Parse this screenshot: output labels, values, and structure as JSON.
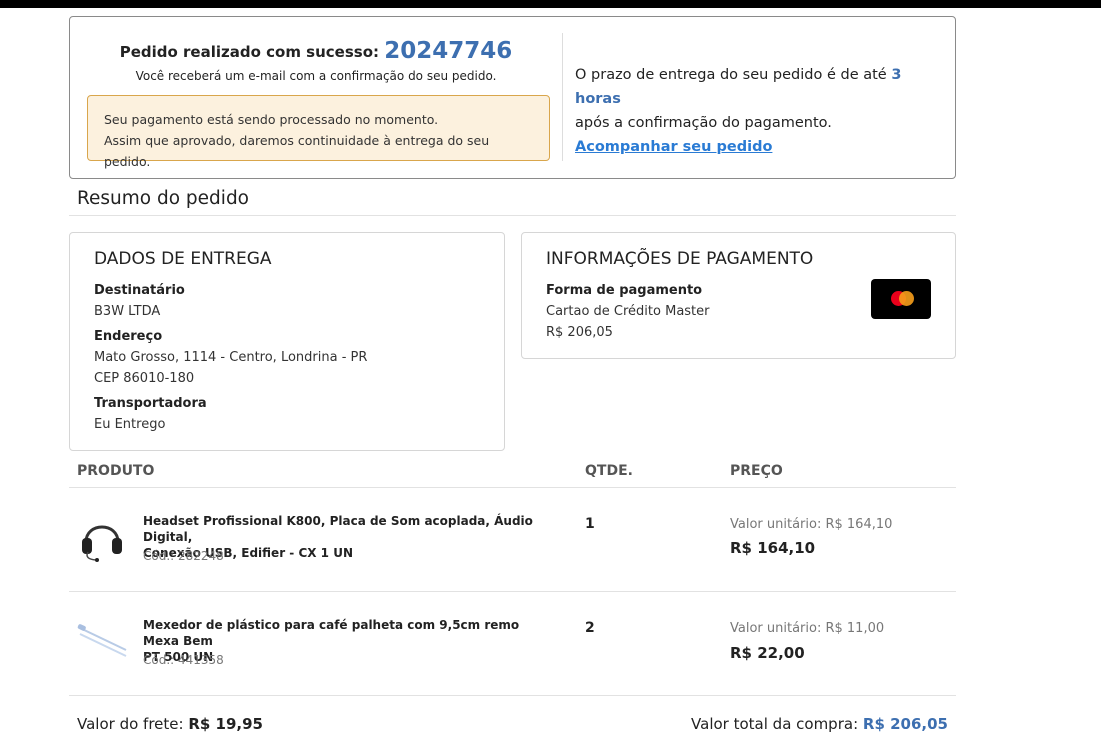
{
  "confirmation": {
    "title_prefix": "Pedido realizado com sucesso:",
    "order_number": "20247746",
    "email_note": "Você receberá um e-mail com a confirmação do seu pedido.",
    "alert_line1": "Seu pagamento está sendo processado no momento.",
    "alert_line2": "Assim que aprovado, daremos continuidade à entrega do seu pedido.",
    "delivery_text_before": "O prazo de entrega do seu pedido é de até",
    "delivery_hours": "3 horas",
    "delivery_text_after": "após a confirmação do pagamento.",
    "track_link": "Acompanhar seu pedido"
  },
  "summary": {
    "title": "Resumo do pedido"
  },
  "delivery": {
    "heading": "DADOS DE ENTREGA",
    "recipient_label": "Destinatário",
    "recipient": "B3W LTDA",
    "address_label": "Endereço",
    "address_line1": "Mato Grosso, 1114 - Centro, Londrina - PR",
    "address_line2": "CEP 86010-180",
    "carrier_label": "Transportadora",
    "carrier": "Eu Entrego"
  },
  "payment": {
    "heading": "INFORMAÇÕES DE PAGAMENTO",
    "method_label": "Forma de pagamento",
    "method": "Cartao de Crédito Master",
    "amount": "R$ 206,05",
    "card_icon": "mastercard-icon"
  },
  "table": {
    "headers": {
      "product": "PRODUTO",
      "qty": "QTDE.",
      "price": "PREÇO"
    },
    "items": [
      {
        "name_line1": "Headset Profissional K800, Placa de Som acoplada, Áudio Digital,",
        "name_line2": "Conexão USB, Edifier - CX 1 UN",
        "code": "Cód.: 282248",
        "qty": "1",
        "unit_price": "Valor unitário: R$ 164,10",
        "total": "R$ 164,10",
        "image": "headset-icon"
      },
      {
        "name_line1": "Mexedor de plástico para café palheta com 9,5cm remo Mexa Bem",
        "name_line2": "PT 500 UN",
        "code": "Cód.: 441358",
        "qty": "2",
        "unit_price": "Valor unitário: R$ 11,00",
        "total": "R$ 22,00",
        "image": "stirrer-icon"
      }
    ]
  },
  "footer": {
    "freight_label": "Valor do frete:",
    "freight_value": "R$ 19,95",
    "total_label": "Valor total da compra:",
    "total_value": "R$ 206,05"
  },
  "colors": {
    "accent": "#3d6fb0",
    "link": "#2a7bd4",
    "alert_bg": "#fcf1de",
    "alert_border": "#d9a64c"
  }
}
